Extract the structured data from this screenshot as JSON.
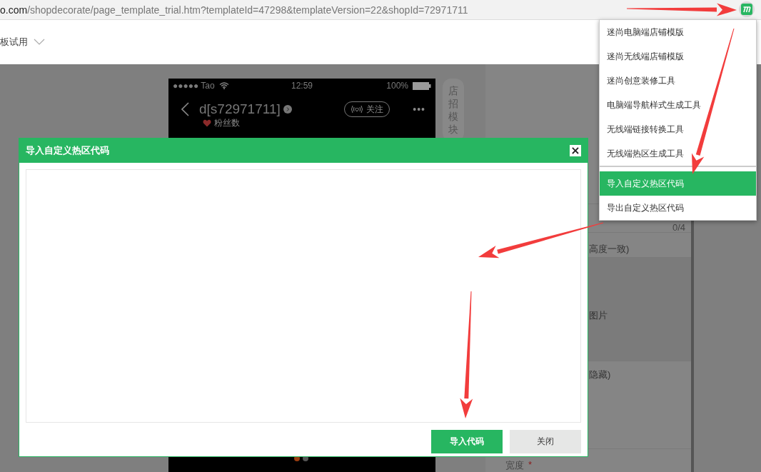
{
  "address_bar": {
    "url_host": "o.com",
    "url_path": "/shopdecorate/page_template_trial.htm?templateId=47298&templateVersion=22&shopId=72971711"
  },
  "toolbar": {
    "label": "板试用"
  },
  "phone_preview": {
    "carrier": "●●●●● Tao",
    "time": "12:59",
    "battery": "100%",
    "shop_name": "d[s72971711]",
    "follow_button": "关注",
    "more": "•••",
    "fans_label": "粉丝数",
    "carousel_dots": [
      {
        "selected": true
      },
      {
        "selected": false
      }
    ]
  },
  "side_tab": {
    "label": "店招模块"
  },
  "settings_panel": {
    "counter": "0/4",
    "notes": [
      "高度一致)",
      "图片",
      "隐藏)"
    ],
    "width_label": "宽度",
    "required_mark": "*"
  },
  "extension_menu": {
    "sections": [
      {
        "items": [
          {
            "label": "迷尚电脑端店铺模版",
            "selected": false
          },
          {
            "label": "迷尚无线端店铺模版",
            "selected": false
          },
          {
            "label": "迷尚创意装修工具",
            "selected": false
          },
          {
            "label": "电脑端导航样式生成工具",
            "selected": false
          },
          {
            "label": "无线端链接转换工具",
            "selected": false
          },
          {
            "label": "无线端热区生成工具",
            "selected": false
          }
        ]
      },
      {
        "items": [
          {
            "label": "导入自定义热区代码",
            "selected": true
          },
          {
            "label": "导出自定义热区代码",
            "selected": false
          }
        ]
      }
    ]
  },
  "dialog": {
    "title": "导入自定义热区代码",
    "close": "×",
    "buttons": [
      {
        "label": "导入代码",
        "kind": "primary"
      },
      {
        "label": "关闭",
        "kind": "secondary"
      }
    ]
  }
}
